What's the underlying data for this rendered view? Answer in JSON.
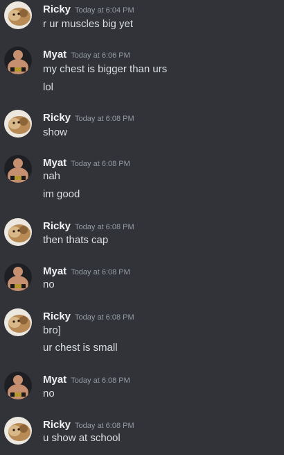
{
  "messages": [
    {
      "author": "Ricky",
      "time": "Today at 6:04 PM",
      "avatar": "ricky-avatar",
      "lines": [
        "r ur muscles big yet"
      ]
    },
    {
      "author": "Myat",
      "time": "Today at 6:06 PM",
      "avatar": "myat-avatar",
      "lines": [
        "my chest is bigger than urs",
        "lol"
      ]
    },
    {
      "author": "Ricky",
      "time": "Today at 6:08 PM",
      "avatar": "ricky-avatar",
      "lines": [
        "show"
      ]
    },
    {
      "author": "Myat",
      "time": "Today at 6:08 PM",
      "avatar": "myat-avatar",
      "lines": [
        "nah",
        "im good"
      ]
    },
    {
      "author": "Ricky",
      "time": "Today at 6:08 PM",
      "avatar": "ricky-avatar",
      "lines": [
        "then thats cap"
      ]
    },
    {
      "author": "Myat",
      "time": "Today at 6:08 PM",
      "avatar": "myat-avatar",
      "lines": [
        "no"
      ]
    },
    {
      "author": "Ricky",
      "time": "Today at 6:08 PM",
      "avatar": "ricky-avatar",
      "lines": [
        "bro]",
        "ur chest is small"
      ]
    },
    {
      "author": "Myat",
      "time": "Today at 6:08 PM",
      "avatar": "myat-avatar",
      "lines": [
        "no"
      ]
    },
    {
      "author": "Ricky",
      "time": "Today at 6:08 PM",
      "avatar": "ricky-avatar",
      "lines": [
        "u show at school"
      ]
    }
  ],
  "colors": {
    "background": "#313338",
    "author": "#f2f3f5",
    "timestamp": "#949ba4",
    "text": "#dbdee1"
  }
}
